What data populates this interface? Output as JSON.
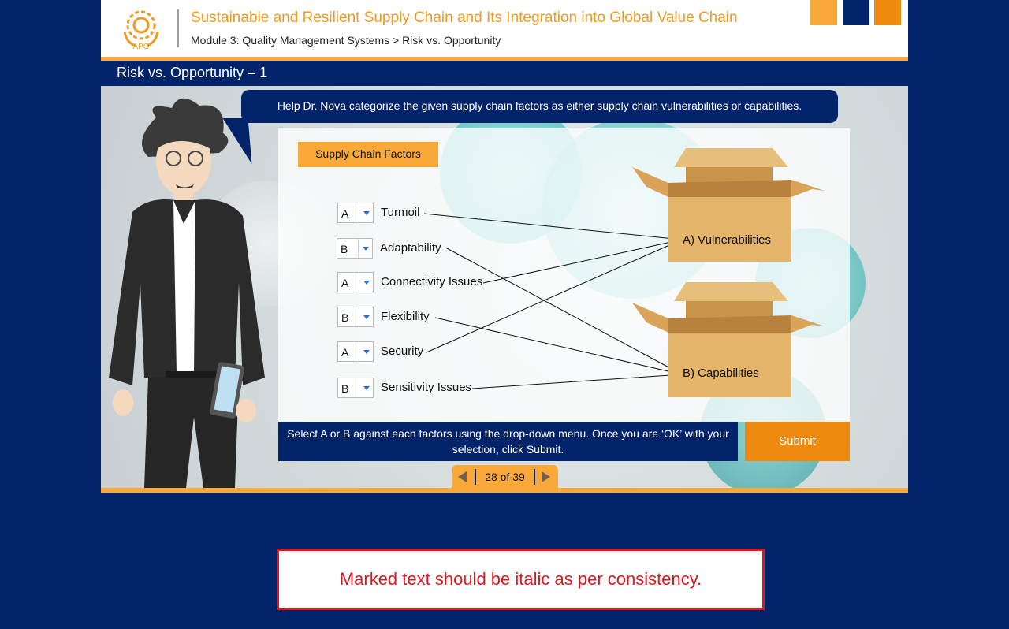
{
  "header": {
    "course_title": "Sustainable and Resilient Supply Chain and Its Integration into Global Value Chain",
    "breadcrumb": "Module 3: Quality Management Systems > Risk vs. Opportunity",
    "logo_text": "APO",
    "expand_icon": "»"
  },
  "slide": {
    "title": "Risk vs. Opportunity – 1",
    "prompt": "Help Dr. Nova categorize the given supply chain factors as either supply chain vulnerabilities or capabilities.",
    "panel_tag": "Supply Chain Factors"
  },
  "factors": [
    {
      "value": "A",
      "label": "Turmoil"
    },
    {
      "value": "B",
      "label": "Adaptability"
    },
    {
      "value": "A",
      "label": "Connectivity Issues"
    },
    {
      "value": "B",
      "label": "Flexibility"
    },
    {
      "value": "A",
      "label": "Security"
    },
    {
      "value": "B",
      "label": "Sensitivity Issues"
    }
  ],
  "categories": [
    {
      "key": "A)",
      "label": "Vulnerabilities"
    },
    {
      "key": "B)",
      "label": "Capabilities"
    }
  ],
  "instructions": "Select A or B against each factors using the drop-down menu. Once you are ‘OK’ with your selection, click Submit.",
  "submit_label": "Submit",
  "pager": {
    "text": "28 of 39"
  },
  "review_note": "Marked text should be italic as per consistency.",
  "colors": {
    "navy": "#01236a",
    "orange": "#f9a83a",
    "dark_orange": "#ef8a10",
    "title_orange": "#f29a1f",
    "note_red": "#e3141e"
  }
}
